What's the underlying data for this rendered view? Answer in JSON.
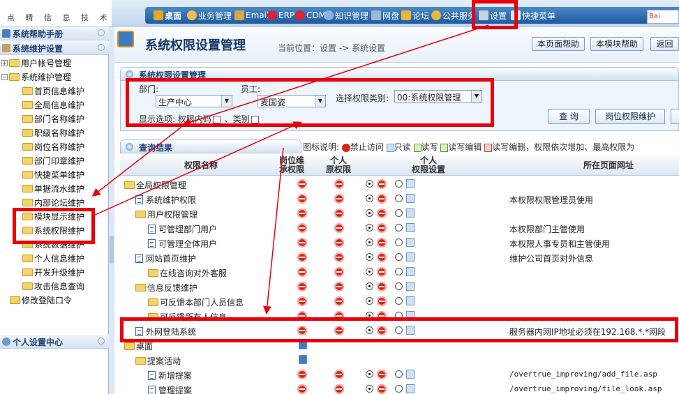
{
  "logo": {
    "sub": "点 睛 信 息 技 术"
  },
  "topnav": {
    "items": [
      "桌面",
      "业务管理",
      "Email",
      "ERP",
      "CDM",
      "知识管理",
      "网盘",
      "论坛",
      "公共服务",
      "设置",
      "快捷菜单"
    ],
    "search_badge": "Bai"
  },
  "sidebar": {
    "help_title": "系统帮助手册",
    "maint_title": "系统维护设置",
    "user_accounts": "用户帐号管理",
    "sys_maint": "系统维护管理",
    "children": [
      "首页信息维护",
      "全局信息维护",
      "部门名称维护",
      "职级名称维护",
      "岗位名称维护",
      "部门印章维护",
      "快捷菜单维护",
      "单据流水维护",
      "内部论坛维护",
      "模块显示维护",
      "系统权限维护",
      "系统数据维护",
      "个人信息维护",
      "开发升级维护",
      "攻击信息查询"
    ],
    "change_pwd": "修改登陆口令",
    "personal_center": "个人设置中心"
  },
  "page": {
    "title": "系统权限设置管理",
    "breadcrumb": "当前位置：设置 -> 系统设置",
    "btn_page_help": "本页面帮助",
    "btn_module_help": "本模块帮助",
    "btn_back": "返回"
  },
  "filter": {
    "panel_title": "系统权限设置管理",
    "dept_label": "部门:",
    "dept_value": "生产中心",
    "staff_label": "员工:",
    "staff_value": "麦国姿",
    "type_label": "选择权限类别:",
    "type_value": "00:系统权限管理",
    "opts_label": "显示选项:",
    "opt_code": "权限内码",
    "opt_class": "、类别",
    "btn_query": "查 询",
    "btn_post": "岗位权限维护"
  },
  "results": {
    "panel_title": "查询结果",
    "legend": [
      "图标说明:",
      "禁止访问",
      "只读",
      "读写",
      "读写编辑",
      "读写编删，权限依次增加、最高权限为"
    ],
    "col_name": "权限名称",
    "col_post": [
      "岗位维",
      "承权限"
    ],
    "col_personal": [
      "个人",
      "原权限"
    ],
    "col_personal_set": [
      "个人",
      "权限设置"
    ],
    "col_url": "所在页面网址",
    "rows": [
      {
        "label": "全局权限管理",
        "url": ""
      },
      {
        "label": "系统维护权限",
        "url": "本权限权限管理员使用"
      },
      {
        "label": "用户权限管理",
        "url": ""
      },
      {
        "label": "可管理部门用户",
        "url": "本权限部门主管使用"
      },
      {
        "label": "可管理全体用户",
        "url": "本权限人事专员和主管使用"
      },
      {
        "label": "网站首页维护",
        "url": "维护公司首页对外信息"
      },
      {
        "label": "在线咨询对外客服",
        "url": ""
      },
      {
        "label": "信息反馈维护",
        "url": ""
      },
      {
        "label": "可反馈本部门人员信息",
        "url": ""
      },
      {
        "label": "可反馈所有人信息",
        "url": ""
      },
      {
        "label": "外网登陆系统",
        "url": "服务器内网IP地址必须在192.168.*.*网段"
      },
      {
        "label": "桌面",
        "url": ""
      },
      {
        "label": "提案活动",
        "url": ""
      },
      {
        "label": "新增提案",
        "url": "/overtrue_improving/add_file.asp"
      },
      {
        "label": "管理提案",
        "url": "/overtrue_improving/file_look.asp"
      }
    ]
  }
}
